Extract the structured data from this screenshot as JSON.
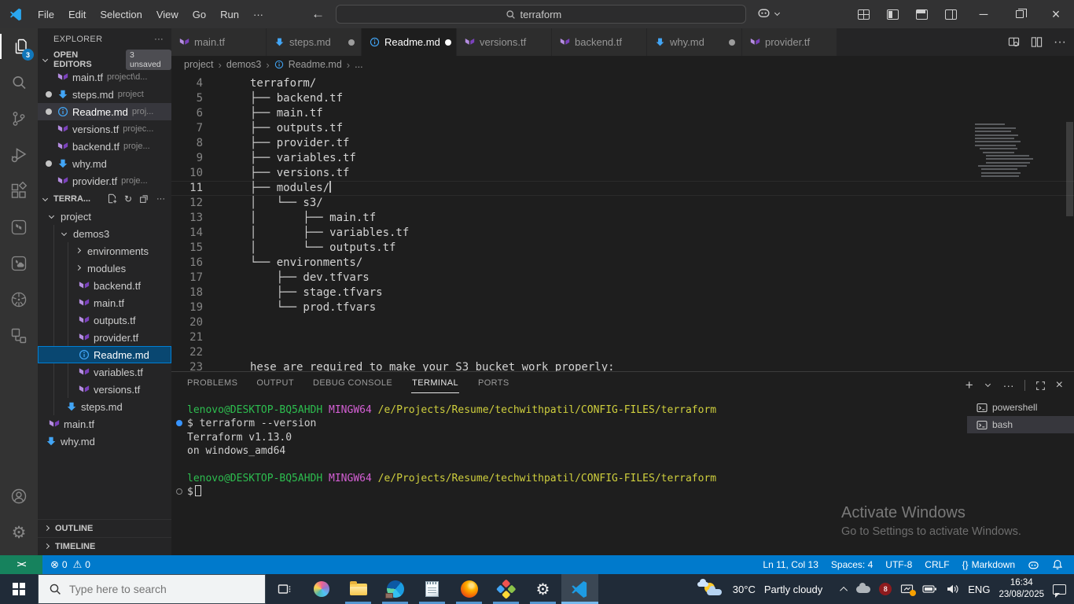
{
  "titlebar": {
    "menus": [
      "File",
      "Edit",
      "Selection",
      "View",
      "Go",
      "Run"
    ],
    "menu_overflow": "···",
    "search_value": "terraform",
    "icons": [
      "vscode-logo",
      "back-arrow",
      "forward-arrow",
      "search-icon",
      "copilot-icon",
      "customize-layout-icon",
      "toggle-primary-sidebar-icon",
      "toggle-panel-icon",
      "toggle-secondary-sidebar-icon",
      "minimize-icon",
      "restore-icon",
      "close-icon"
    ]
  },
  "activity_bar": {
    "badge": "3",
    "icons": [
      "explorer-icon",
      "search-icon",
      "source-control-icon",
      "run-and-debug-icon",
      "extensions-icon",
      "terraform-icon",
      "terraform-cloud-icon",
      "kubernetes-icon",
      "containers-icon",
      "account-icon",
      "settings-gear-icon"
    ]
  },
  "sidebar": {
    "title": "EXPLORER",
    "open_editors": {
      "label": "OPEN EDITORS",
      "badge": "3 unsaved",
      "items": [
        {
          "name": "main.tf",
          "detail": "project\\d...",
          "icon": "terraform-file-icon",
          "dirty": false,
          "active": false
        },
        {
          "name": "steps.md",
          "detail": "project",
          "icon": "markdown-file-icon",
          "dirty": true,
          "active": false
        },
        {
          "name": "Readme.md",
          "detail": "proj...",
          "icon": "info-file-icon",
          "dirty": true,
          "active": true
        },
        {
          "name": "versions.tf",
          "detail": "projec...",
          "icon": "terraform-file-icon",
          "dirty": false,
          "active": false
        },
        {
          "name": "backend.tf",
          "detail": "proje...",
          "icon": "terraform-file-icon",
          "dirty": false,
          "active": false
        },
        {
          "name": "why.md",
          "detail": "",
          "icon": "markdown-file-icon",
          "dirty": true,
          "active": false
        },
        {
          "name": "provider.tf",
          "detail": "proje...",
          "icon": "terraform-file-icon",
          "dirty": false,
          "active": false
        }
      ]
    },
    "workspace": {
      "label": "TERRA...",
      "actions": [
        "new-file-icon",
        "refresh-icon",
        "collapse-folders-icon",
        "more-actions-icon"
      ],
      "tree": [
        {
          "label": "project",
          "level": 0,
          "kind": "folder-expanded"
        },
        {
          "label": "demos3",
          "level": 1,
          "kind": "folder-expanded"
        },
        {
          "label": "environments",
          "level": 2,
          "kind": "folder-collapsed"
        },
        {
          "label": "modules",
          "level": 2,
          "kind": "folder-collapsed"
        },
        {
          "label": "backend.tf",
          "level": 2,
          "kind": "terraform-file"
        },
        {
          "label": "main.tf",
          "level": 2,
          "kind": "terraform-file"
        },
        {
          "label": "outputs.tf",
          "level": 2,
          "kind": "terraform-file"
        },
        {
          "label": "provider.tf",
          "level": 2,
          "kind": "terraform-file"
        },
        {
          "label": "Readme.md",
          "level": 2,
          "kind": "info-file",
          "selected": true
        },
        {
          "label": "variables.tf",
          "level": 2,
          "kind": "terraform-file"
        },
        {
          "label": "versions.tf",
          "level": 2,
          "kind": "terraform-file"
        },
        {
          "label": "steps.md",
          "level": 1,
          "kind": "markdown-file"
        },
        {
          "label": "main.tf",
          "level": 0,
          "kind": "terraform-file"
        },
        {
          "label": "why.md",
          "level": 0,
          "kind": "markdown-file"
        }
      ]
    },
    "outline_label": "OUTLINE",
    "timeline_label": "TIMELINE"
  },
  "tabs": [
    {
      "label": "main.tf",
      "icon": "terraform-file-icon",
      "dirty": false,
      "active": false
    },
    {
      "label": "steps.md",
      "icon": "markdown-file-icon",
      "dirty": true,
      "active": false
    },
    {
      "label": "Readme.md",
      "icon": "info-file-icon",
      "dirty": true,
      "active": true
    },
    {
      "label": "versions.tf",
      "icon": "terraform-file-icon",
      "dirty": false,
      "active": false
    },
    {
      "label": "backend.tf",
      "icon": "terraform-file-icon",
      "dirty": false,
      "active": false
    },
    {
      "label": "why.md",
      "icon": "markdown-file-icon",
      "dirty": true,
      "active": false
    },
    {
      "label": "provider.tf",
      "icon": "terraform-file-icon",
      "dirty": false,
      "active": false
    }
  ],
  "editor_actions": [
    "open-preview-icon",
    "split-editor-icon",
    "more-actions-icon"
  ],
  "breadcrumb": {
    "items": [
      "project",
      "demos3",
      "Readme.md",
      "..."
    ]
  },
  "editor": {
    "current_line": "11",
    "lines": [
      {
        "n": "4",
        "text": "terraform/"
      },
      {
        "n": "5",
        "text": "├── backend.tf"
      },
      {
        "n": "6",
        "text": "├── main.tf"
      },
      {
        "n": "7",
        "text": "├── outputs.tf"
      },
      {
        "n": "8",
        "text": "├── provider.tf"
      },
      {
        "n": "9",
        "text": "├── variables.tf"
      },
      {
        "n": "10",
        "text": "├── versions.tf"
      },
      {
        "n": "11",
        "text": "├── modules/"
      },
      {
        "n": "12",
        "text": "│   └── s3/"
      },
      {
        "n": "13",
        "text": "│       ├── main.tf"
      },
      {
        "n": "14",
        "text": "│       ├── variables.tf"
      },
      {
        "n": "15",
        "text": "│       └── outputs.tf"
      },
      {
        "n": "16",
        "text": "└── environments/"
      },
      {
        "n": "17",
        "text": "    ├── dev.tfvars"
      },
      {
        "n": "18",
        "text": "    ├── stage.tfvars"
      },
      {
        "n": "19",
        "text": "    └── prod.tfvars"
      },
      {
        "n": "20",
        "text": ""
      },
      {
        "n": "21",
        "text": ""
      },
      {
        "n": "22",
        "text": ""
      },
      {
        "n": "23",
        "text": "hese are required to make your S3 bucket work properly:"
      }
    ]
  },
  "panel": {
    "tabs": [
      "PROBLEMS",
      "OUTPUT",
      "DEBUG CONSOLE",
      "TERMINAL",
      "PORTS"
    ],
    "active_tab": "TERMINAL",
    "actions": [
      "new-terminal-icon",
      "launch-profile-chevron-icon",
      "more-actions-icon",
      "maximize-panel-icon",
      "close-panel-icon"
    ],
    "terminal": {
      "prompt_user": "lenovo@DESKTOP-BQ5AHDH",
      "prompt_env": "MINGW64",
      "prompt_path": "/e/Projects/Resume/techwithpatil/CONFIG-FILES/terraform",
      "command": "$ terraform --version",
      "output_line1": "Terraform v1.13.0",
      "output_line2": "on windows_amd64",
      "prompt_char": "$",
      "shells": [
        {
          "label": "powershell",
          "icon": "terminal-icon",
          "active": false
        },
        {
          "label": "bash",
          "icon": "terminal-icon",
          "active": true
        }
      ]
    }
  },
  "watermark": {
    "title": "Activate Windows",
    "subtitle": "Go to Settings to activate Windows."
  },
  "status_bar": {
    "remote_icon": "remote-indicator-icon",
    "errors": "0",
    "warnings": "0",
    "line_col": "Ln 11, Col 13",
    "indentation": "Spaces: 4",
    "encoding": "UTF-8",
    "eol": "CRLF",
    "language_icon": "{}",
    "language": "Markdown",
    "right_icons": [
      "copilot-icon",
      "bell-icon"
    ]
  },
  "taskbar": {
    "search_placeholder": "Type here to search",
    "apps": [
      "start-button",
      "search-box",
      "task-view-icon",
      "copilot-icon",
      "file-explorer-icon",
      "edge-icon",
      "notepad-icon",
      "firefox-icon",
      "shapes-app-icon",
      "settings-icon",
      "vscode-icon"
    ],
    "weather_temp": "30°C",
    "weather_condition": "Partly cloudy",
    "tray_icons": [
      "chevron-up-icon",
      "onedrive-cloud-icon",
      "red-app-tray-icon",
      "display-connect-icon",
      "battery-icon",
      "volume-icon"
    ],
    "language": "ENG",
    "time": "16:34",
    "date": "23/08/2025",
    "notification_icon": "notification-bubble-icon"
  }
}
